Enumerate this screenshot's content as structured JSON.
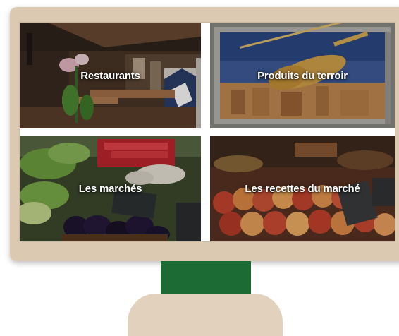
{
  "tiles": [
    {
      "label": "Restaurants",
      "photo_icon": "restaurant-interior-photo"
    },
    {
      "label": "Produits du terroir",
      "photo_icon": "violin-display-photo"
    },
    {
      "label": "Les marchés",
      "photo_icon": "vegetable-market-photo"
    },
    {
      "label": "Les recettes du marché",
      "photo_icon": "fruit-stall-photo"
    }
  ],
  "colors": {
    "frame": "#dcc9b1",
    "stand_neck": "#1c6b34",
    "stand_base": "#e1d1bd",
    "label_text": "#ffffff"
  }
}
